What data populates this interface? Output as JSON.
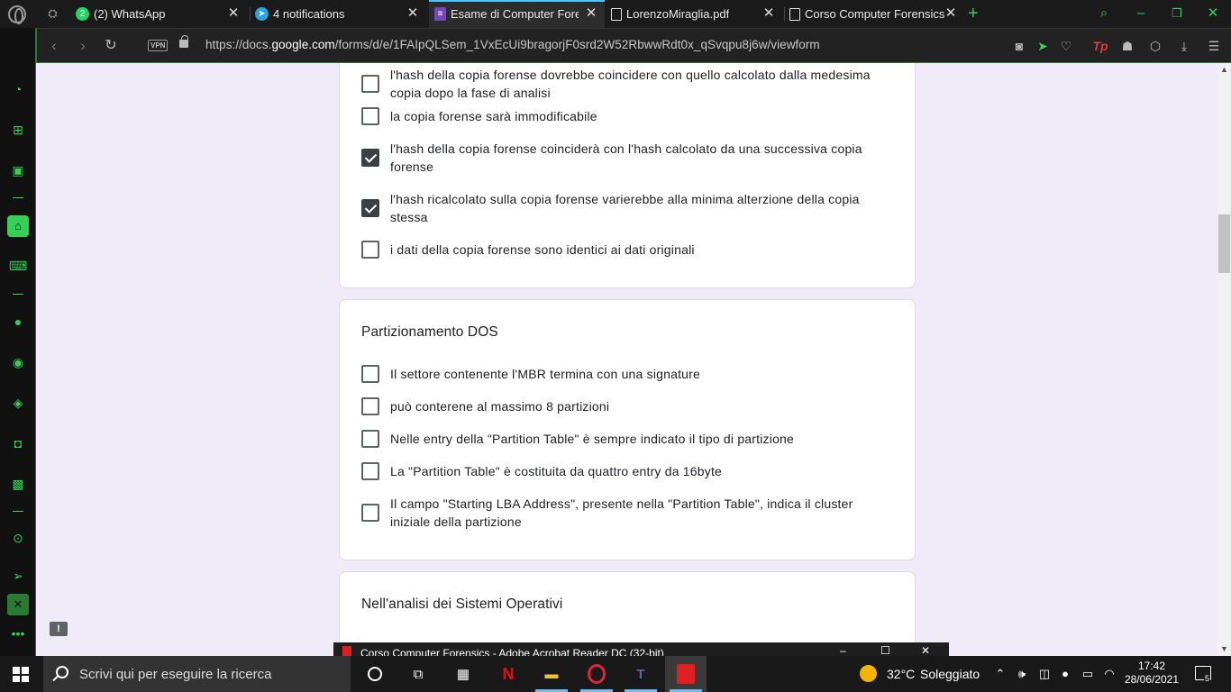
{
  "browser": {
    "tabs": [
      {
        "title": "(2) WhatsApp",
        "badge": "2"
      },
      {
        "title": "4 notifications"
      },
      {
        "title": "Esame di Computer Forensics"
      },
      {
        "title": "LorenzoMiraglia.pdf"
      },
      {
        "title": "Corso Computer Forensics"
      }
    ],
    "vpn_label": "VPN",
    "url_prefix": "https://docs.",
    "url_domain": "google.com",
    "url_path": "/forms/d/e/1FAIpQLSem_1VxEcUi9bragorjF0srd2W52RbwwRdt0x_qSvqpu8j6w/viewform",
    "colors": {
      "accent": "#34d058",
      "active_tab_line": "#4fc2f7"
    }
  },
  "form": {
    "card1": {
      "options": [
        {
          "label": "l'hash della copia forense dovrebbe coincidere con quello calcolato dalla medesima copia dopo la fase di analisi",
          "checked": false
        },
        {
          "label": "la copia forense sarà immodificabile",
          "checked": false
        },
        {
          "label": "l'hash della copia forense coinciderà con l'hash calcolato da una successiva copia forense",
          "checked": true
        },
        {
          "label": "l'hash ricalcolato sulla copia forense varierebbe alla minima alterzione della copia stessa",
          "checked": true
        },
        {
          "label": "i dati della copia forense sono identici ai dati originali",
          "checked": false
        }
      ]
    },
    "card2": {
      "title": "Partizionamento DOS",
      "options": [
        {
          "label": "Il settore contenente l'MBR termina con una signature",
          "checked": false
        },
        {
          "label": "può conterene al massimo 8 partizioni",
          "checked": false
        },
        {
          "label": "Nelle entry della \"Partition Table\" è sempre indicato il tipo di partizione",
          "checked": false
        },
        {
          "label": "La \"Partition Table\" è costituita da quattro entry da 16byte",
          "checked": false
        },
        {
          "label": "Il campo \"Starting LBA Address\", presente nella \"Partition Table\", indica il cluster iniziale della partizione",
          "checked": false
        }
      ]
    },
    "card3": {
      "title": "Nell'analisi dei Sistemi Operativi"
    }
  },
  "acrobat_window": {
    "title": "Corso Computer Forensics - Adobe Acrobat Reader DC (32-bit)"
  },
  "taskbar": {
    "search_placeholder": "Scrivi qui per eseguire la ricerca",
    "weather_temp": "32°C",
    "weather_desc": "Soleggiato",
    "time": "17:42",
    "date": "28/06/2021",
    "notification_count": "5"
  }
}
